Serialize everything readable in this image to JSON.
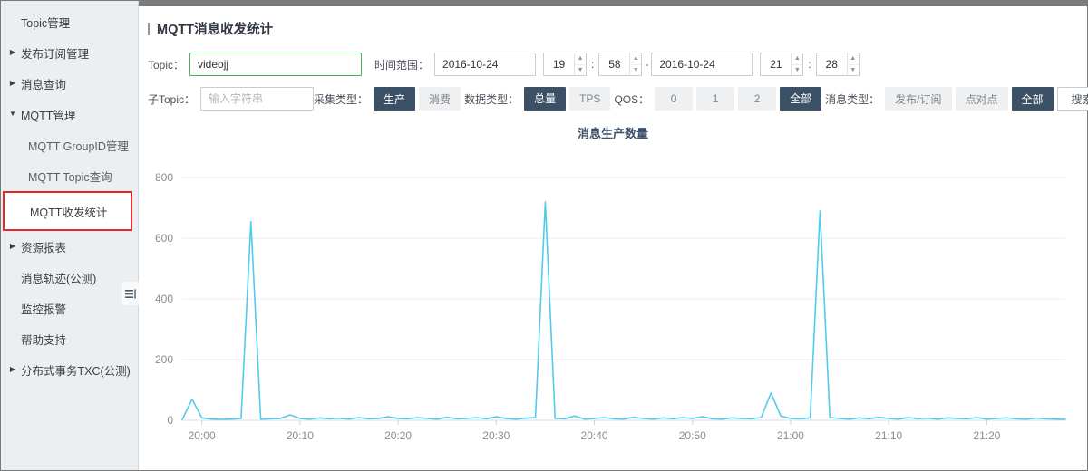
{
  "sidebar": {
    "items": [
      {
        "label": "Topic管理",
        "arrow": "",
        "level": 0,
        "selected": false
      },
      {
        "label": "发布订阅管理",
        "arrow": "▶",
        "level": 0,
        "selected": false
      },
      {
        "label": "消息查询",
        "arrow": "▶",
        "level": 0,
        "selected": false
      },
      {
        "label": "MQTT管理",
        "arrow": "▼",
        "level": 0,
        "selected": false
      },
      {
        "label": "MQTT GroupID管理",
        "arrow": "",
        "level": 1,
        "selected": false
      },
      {
        "label": "MQTT Topic查询",
        "arrow": "",
        "level": 1,
        "selected": false
      },
      {
        "label": "MQTT收发统计",
        "arrow": "",
        "level": 1,
        "selected": true
      },
      {
        "label": "资源报表",
        "arrow": "▶",
        "level": 0,
        "selected": false
      },
      {
        "label": "消息轨迹(公测)",
        "arrow": "",
        "level": 0,
        "selected": false
      },
      {
        "label": "监控报警",
        "arrow": "",
        "level": 0,
        "selected": false
      },
      {
        "label": "帮助支持",
        "arrow": "",
        "level": 0,
        "selected": false
      },
      {
        "label": "分布式事务TXC(公测)",
        "arrow": "▶",
        "level": 0,
        "selected": false
      }
    ],
    "collapse_icon": "collapse-panel-icon"
  },
  "header": {
    "title": "MQTT消息收发统计"
  },
  "filters": {
    "topic_label": "Topic：",
    "topic_value": "videojj",
    "topic_placeholder": "",
    "subtopic_label": "子Topic：",
    "subtopic_value": "",
    "subtopic_placeholder": "输入字符串",
    "time_range_label": "时间范围：",
    "start_date": "2016-10-24",
    "start_hour": "19",
    "start_minute": "58",
    "range_separator": "-",
    "end_date": "2016-10-24",
    "end_hour": "21",
    "end_minute": "28",
    "time_colon": "：",
    "collect_type_label": "采集类型：",
    "collect_types": [
      {
        "label": "生产",
        "active": true
      },
      {
        "label": "消费",
        "active": false
      }
    ],
    "data_type_label": "数据类型：",
    "data_types": [
      {
        "label": "总量",
        "active": true
      },
      {
        "label": "TPS",
        "active": false
      }
    ],
    "qos_label": "QOS：",
    "qos_options": [
      {
        "label": "0",
        "active": false
      },
      {
        "label": "1",
        "active": false
      },
      {
        "label": "2",
        "active": false
      },
      {
        "label": "全部",
        "active": true
      }
    ],
    "msg_type_label": "消息类型：",
    "msg_types": [
      {
        "label": "发布/订阅",
        "active": false
      },
      {
        "label": "点对点",
        "active": false
      },
      {
        "label": "全部",
        "active": true
      }
    ],
    "search_label": "搜索"
  },
  "colors": {
    "line": "#52cbeb",
    "active_button": "#3d5166",
    "inactive_button": "#eef0f2",
    "focus_border": "#4caf50",
    "selection_outline": "#e8262b",
    "title_text": "#3c5168"
  },
  "chart_data": {
    "type": "line",
    "title": "消息生产数量",
    "xlabel": "",
    "ylabel": "",
    "ylim": [
      0,
      860
    ],
    "yticks": [
      0,
      200,
      400,
      600,
      800
    ],
    "xticks": [
      "20:00",
      "20:10",
      "20:20",
      "20:30",
      "20:40",
      "20:50",
      "21:00",
      "21:10",
      "21:20"
    ],
    "xlim": [
      "19:58",
      "21:28"
    ],
    "grid": true,
    "legend": "none",
    "series": [
      {
        "name": "消息生产数量",
        "color": "#52cbeb",
        "x": [
          "19:58",
          "19:59",
          "20:00",
          "20:01",
          "20:02",
          "20:03",
          "20:04",
          "20:05",
          "20:06",
          "20:07",
          "20:08",
          "20:09",
          "20:10",
          "20:11",
          "20:12",
          "20:13",
          "20:14",
          "20:15",
          "20:16",
          "20:17",
          "20:18",
          "20:19",
          "20:20",
          "20:21",
          "20:22",
          "20:23",
          "20:24",
          "20:25",
          "20:26",
          "20:27",
          "20:28",
          "20:29",
          "20:30",
          "20:31",
          "20:32",
          "20:33",
          "20:34",
          "20:35",
          "20:36",
          "20:37",
          "20:38",
          "20:39",
          "20:40",
          "20:41",
          "20:42",
          "20:43",
          "20:44",
          "20:45",
          "20:46",
          "20:47",
          "20:48",
          "20:49",
          "20:50",
          "20:51",
          "20:52",
          "20:53",
          "20:54",
          "20:55",
          "20:56",
          "20:57",
          "20:58",
          "20:59",
          "21:00",
          "21:01",
          "21:02",
          "21:03",
          "21:04",
          "21:05",
          "21:06",
          "21:07",
          "21:08",
          "21:09",
          "21:10",
          "21:11",
          "21:12",
          "21:13",
          "21:14",
          "21:15",
          "21:16",
          "21:17",
          "21:18",
          "21:19",
          "21:20",
          "21:21",
          "21:22",
          "21:23",
          "21:24",
          "21:25",
          "21:26",
          "21:27",
          "21:28"
        ],
        "values": [
          2,
          70,
          8,
          4,
          3,
          4,
          6,
          655,
          4,
          5,
          6,
          18,
          6,
          4,
          8,
          5,
          7,
          4,
          9,
          5,
          6,
          12,
          6,
          5,
          9,
          6,
          4,
          10,
          5,
          6,
          9,
          5,
          12,
          6,
          4,
          7,
          9,
          720,
          6,
          5,
          14,
          4,
          6,
          9,
          5,
          4,
          10,
          6,
          4,
          8,
          5,
          9,
          6,
          12,
          5,
          4,
          8,
          6,
          5,
          9,
          90,
          14,
          6,
          5,
          8,
          690,
          9,
          6,
          4,
          8,
          5,
          10,
          6,
          4,
          9,
          5,
          7,
          4,
          8,
          6,
          5,
          9,
          4,
          6,
          8,
          5,
          4,
          7,
          5,
          4,
          3
        ]
      }
    ]
  }
}
